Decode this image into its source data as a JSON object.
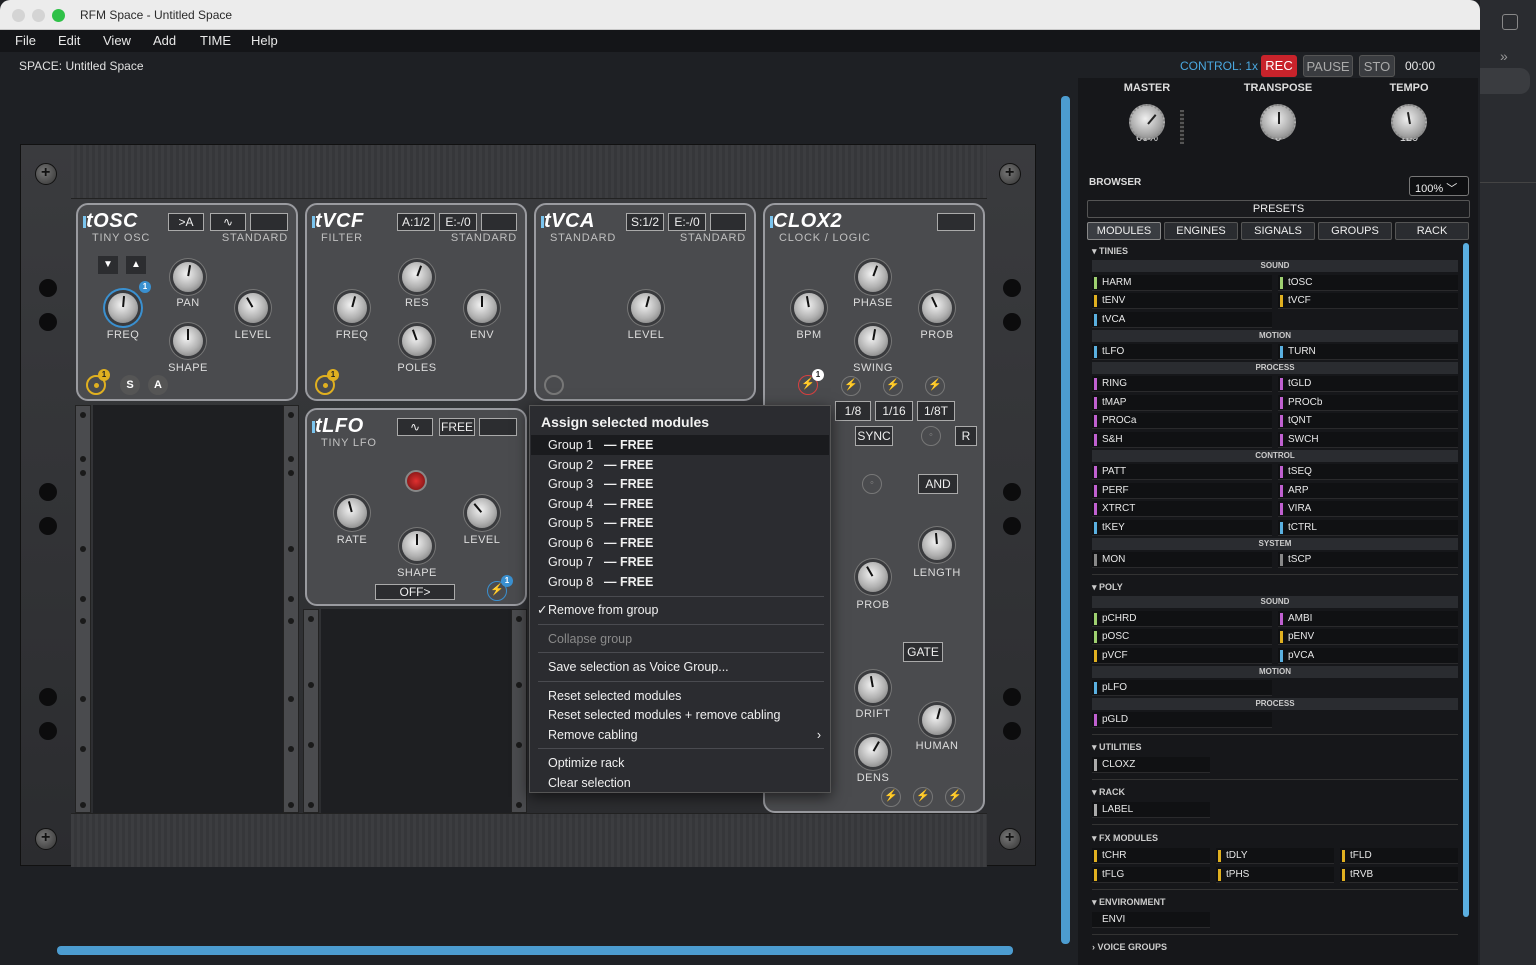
{
  "window": {
    "title": "RFM Space - Untitled Space"
  },
  "menu": [
    "File",
    "Edit",
    "View",
    "Add",
    "TIME",
    "Help"
  ],
  "space_label": "SPACE: Untitled Space",
  "transport": {
    "control": "CONTROL: 1x",
    "rec": "REC",
    "pause": "PAUSE",
    "sto": "STO",
    "time": "00:00",
    "rec_color": "#c8232b"
  },
  "master_knobs": [
    {
      "label": "MASTER",
      "value": "66%"
    },
    {
      "label": "TRANSPOSE",
      "value": "0"
    },
    {
      "label": "TEMPO",
      "value": "120"
    }
  ],
  "browser": {
    "label": "BROWSER",
    "zoom": "100%",
    "presets": "PRESETS",
    "tabs": [
      "MODULES",
      "ENGINES",
      "SIGNALS",
      "GROUPS",
      "RACK"
    ],
    "sections": {
      "tinies": "TINIES",
      "poly": "POLY",
      "utilities": "UTILITIES",
      "rack": "RACK",
      "fx": "FX MODULES",
      "environment": "ENVIRONMENT",
      "voice_groups": "VOICE GROUPS"
    },
    "subsections": {
      "sound": "SOUND",
      "motion": "MOTION",
      "process": "PROCESS",
      "control": "CONTROL",
      "system": "SYSTEM"
    },
    "items": {
      "harm": "HARM",
      "tosc": "tOSC",
      "tenv": "tENV",
      "tvcf": "tVCF",
      "tvca": "tVCA",
      "tlfo": "tLFO",
      "turn": "TURN",
      "ring": "RING",
      "tgld": "tGLD",
      "tmap": "tMAP",
      "procb": "PROCb",
      "proca": "PROCa",
      "tqnt": "tQNT",
      "sh": "S&H",
      "swch": "SWCH",
      "patt": "PATT",
      "tseq": "tSEQ",
      "perf": "PERF",
      "arp": "ARP",
      "xtrct": "XTRCT",
      "vira": "VIRA",
      "tkey": "tKEY",
      "tctrl": "tCTRL",
      "mon": "MON",
      "tscp": "tSCP",
      "pchrd": "pCHRD",
      "ambi": "AMBI",
      "posc": "pOSC",
      "penv": "pENV",
      "pvcf": "pVCF",
      "pvca": "pVCA",
      "plfo": "pLFO",
      "pgld": "pGLD",
      "cloxz": "CLOXZ",
      "label": "LABEL",
      "tchr": "tCHR",
      "tdly": "tDLY",
      "tfld": "tFLD",
      "tflg": "tFLG",
      "tphs": "tPHS",
      "trvb": "tRVB",
      "envi": "ENVI"
    }
  },
  "modules": {
    "tosc": {
      "title": "tOSC",
      "sub": "TINY OSC",
      "type": "STANDARD",
      "btn": ">A",
      "knobs": {
        "freq": "FREQ",
        "pan": "PAN",
        "level": "LEVEL",
        "shape": "SHAPE"
      },
      "s": "S",
      "a": "A",
      "badge": "1"
    },
    "tvcf": {
      "title": "tVCF",
      "sub": "FILTER",
      "type": "STANDARD",
      "btn1": "A:1/2",
      "btn2": "E:-/0",
      "knobs": {
        "freq": "FREQ",
        "res": "RES",
        "env": "ENV",
        "poles": "POLES"
      },
      "badge": "1"
    },
    "tvca": {
      "title": "tVCA",
      "sub": "STANDARD",
      "type": "STANDARD",
      "btn1": "S:1/2",
      "btn2": "E:-/0",
      "knobs": {
        "level": "LEVEL"
      }
    },
    "clox": {
      "title": "CLOX2",
      "sub": "CLOCK / LOGIC",
      "knobs": {
        "bpm": "BPM",
        "phase": "PHASE",
        "prob": "PROB",
        "swing": "SWING",
        "prob2": "PROB",
        "length": "LENGTH",
        "drift": "DRIFT",
        "human": "HUMAN",
        "dens": "DENS"
      },
      "div": [
        "1/8",
        "1/16",
        "1/8T"
      ],
      "sync": "SYNC",
      "r": "R",
      "and": "AND",
      "gate": "GATE",
      "badge": "1"
    },
    "tlfo": {
      "title": "tLFO",
      "sub": "TINY LFO",
      "free": "FREE",
      "knobs": {
        "rate": "RATE",
        "level": "LEVEL",
        "shape": "SHAPE"
      },
      "off": "OFF>",
      "badge": "1"
    }
  },
  "context_menu": {
    "title": "Assign selected modules",
    "groups": [
      {
        "name": "Group 1",
        "status": "— FREE"
      },
      {
        "name": "Group 2",
        "status": "— FREE"
      },
      {
        "name": "Group 3",
        "status": "— FREE"
      },
      {
        "name": "Group 4",
        "status": "— FREE"
      },
      {
        "name": "Group 5",
        "status": "— FREE"
      },
      {
        "name": "Group 6",
        "status": "— FREE"
      },
      {
        "name": "Group 7",
        "status": "— FREE"
      },
      {
        "name": "Group 8",
        "status": "— FREE"
      }
    ],
    "remove_group": "Remove from group",
    "collapse": "Collapse group",
    "save_voice": "Save selection as Voice Group...",
    "reset": "Reset selected modules",
    "reset_cabling": "Reset selected modules + remove cabling",
    "remove_cabling": "Remove cabling",
    "optimize": "Optimize rack",
    "clear": "Clear selection"
  }
}
